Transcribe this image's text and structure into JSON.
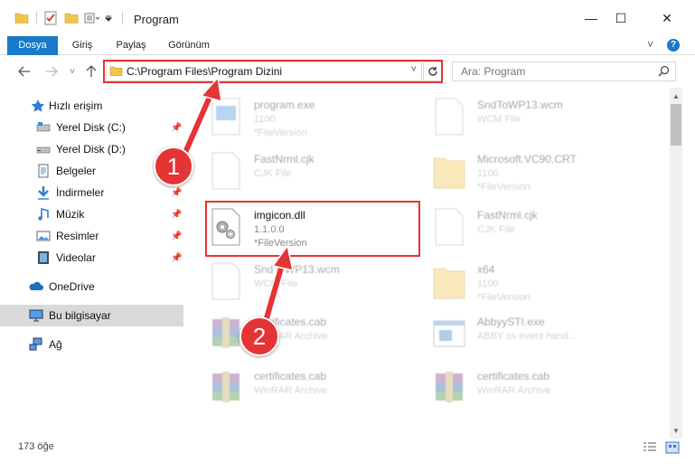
{
  "window": {
    "title": "Program",
    "minimize": "—",
    "maximize": "☐",
    "close": "✕"
  },
  "ribbon": {
    "tabs": [
      {
        "label": "Dosya",
        "active": true
      },
      {
        "label": "Giriş"
      },
      {
        "label": "Paylaş"
      },
      {
        "label": "Görünüm"
      }
    ],
    "expand_icon": "˅",
    "help_icon": "?"
  },
  "address": {
    "path": "C:\\Program Files\\Program Dizini",
    "search_placeholder": "Ara: Program"
  },
  "sidebar": {
    "items": [
      {
        "label": "Hızlı erişim",
        "icon": "star-icon"
      },
      {
        "label": "Yerel Disk (C:)",
        "icon": "drive-icon",
        "pinned": true
      },
      {
        "label": "Yerel Disk (D:)",
        "icon": "drive-icon"
      },
      {
        "label": "Belgeler",
        "icon": "documents-icon",
        "pinned": true
      },
      {
        "label": "İndirmeler",
        "icon": "download-icon",
        "pinned": true
      },
      {
        "label": "Müzik",
        "icon": "music-icon",
        "pinned": true
      },
      {
        "label": "Resimler",
        "icon": "pictures-icon",
        "pinned": true
      },
      {
        "label": "Videolar",
        "icon": "videos-icon",
        "pinned": true
      },
      {
        "label": "OneDrive",
        "icon": "cloud-icon"
      },
      {
        "label": "Bu bilgisayar",
        "icon": "computer-icon",
        "selected": true
      },
      {
        "label": "Ağ",
        "icon": "network-icon"
      }
    ]
  },
  "files": [
    {
      "name": "program.exe",
      "line1": "1100",
      "line2": "*FileVersion",
      "icon": "exe-icon"
    },
    {
      "name": "SndToWP13.wcm",
      "line1": "WCM File",
      "line2": "",
      "icon": "blank-file-icon"
    },
    {
      "name": "FastNrml.cjk",
      "line1": "CJK File",
      "line2": "",
      "icon": "blank-file-icon"
    },
    {
      "name": "Microsoft.VC90.CRT",
      "line1": "1100",
      "line2": "*FileVersion",
      "icon": "folder-icon"
    },
    {
      "name": "imgicon.dll",
      "line1": "1.1.0.0",
      "line2": "*FileVersion",
      "icon": "dll-gear-icon"
    },
    {
      "name": "FastNrml.cjk",
      "line1": "CJK File",
      "line2": "",
      "icon": "blank-file-icon"
    },
    {
      "name": "SndToWP13.wcm",
      "line1": "WCM File",
      "line2": "",
      "icon": "blank-file-icon"
    },
    {
      "name": "x64",
      "line1": "1100",
      "line2": "*FileVersion",
      "icon": "folder-icon"
    },
    {
      "name": "certificates.cab",
      "line1": "WinRAR Archive",
      "line2": "",
      "icon": "winrar-icon"
    },
    {
      "name": "AbbyySTI.exe",
      "line1": "ABBY ss event hand...",
      "line2": "",
      "icon": "app-window-icon"
    },
    {
      "name": "certificates.cab",
      "line1": "WinRAR Archive",
      "line2": "",
      "icon": "winrar-icon"
    },
    {
      "name": "certificates.cab",
      "line1": "WinRAR Archive",
      "line2": "",
      "icon": "winrar-icon"
    }
  ],
  "status": {
    "item_count": "173 öğe"
  },
  "annotations": {
    "step1": "1",
    "step2": "2"
  },
  "colors": {
    "accent": "#1979ca",
    "highlight_red": "#e53434"
  }
}
